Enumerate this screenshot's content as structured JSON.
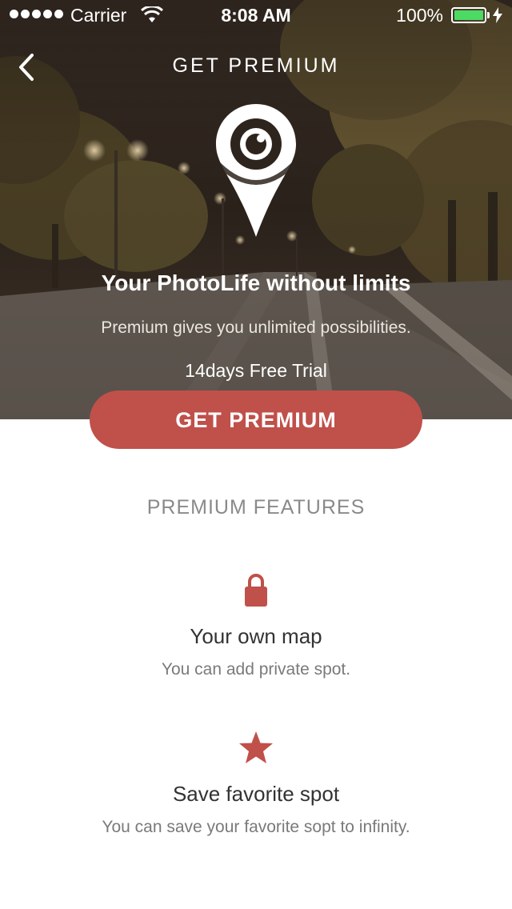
{
  "status_bar": {
    "carrier": "Carrier",
    "time": "8:08 AM",
    "battery": "100%",
    "battery_color": "#4cd964"
  },
  "nav": {
    "title": "GET PREMIUM",
    "back_icon": "chevron-left-icon"
  },
  "hero": {
    "icon": "map-pin-eye-icon",
    "title": "Your PhotoLife without limits",
    "subtitle": "Premium gives you unlimited possibilities.",
    "trial": "14days Free Trial"
  },
  "cta": {
    "label": "GET PREMIUM",
    "color": "#c0504a"
  },
  "features": {
    "heading": "PREMIUM FEATURES",
    "items": [
      {
        "icon": "lock-icon",
        "title": "Your own map",
        "description": "You can add private spot."
      },
      {
        "icon": "star-icon",
        "title": "Save favorite spot",
        "description": "You can save your favorite sopt to infinity."
      }
    ]
  },
  "colors": {
    "accent": "#c0504a",
    "heading_gray": "#8a8a8a"
  }
}
